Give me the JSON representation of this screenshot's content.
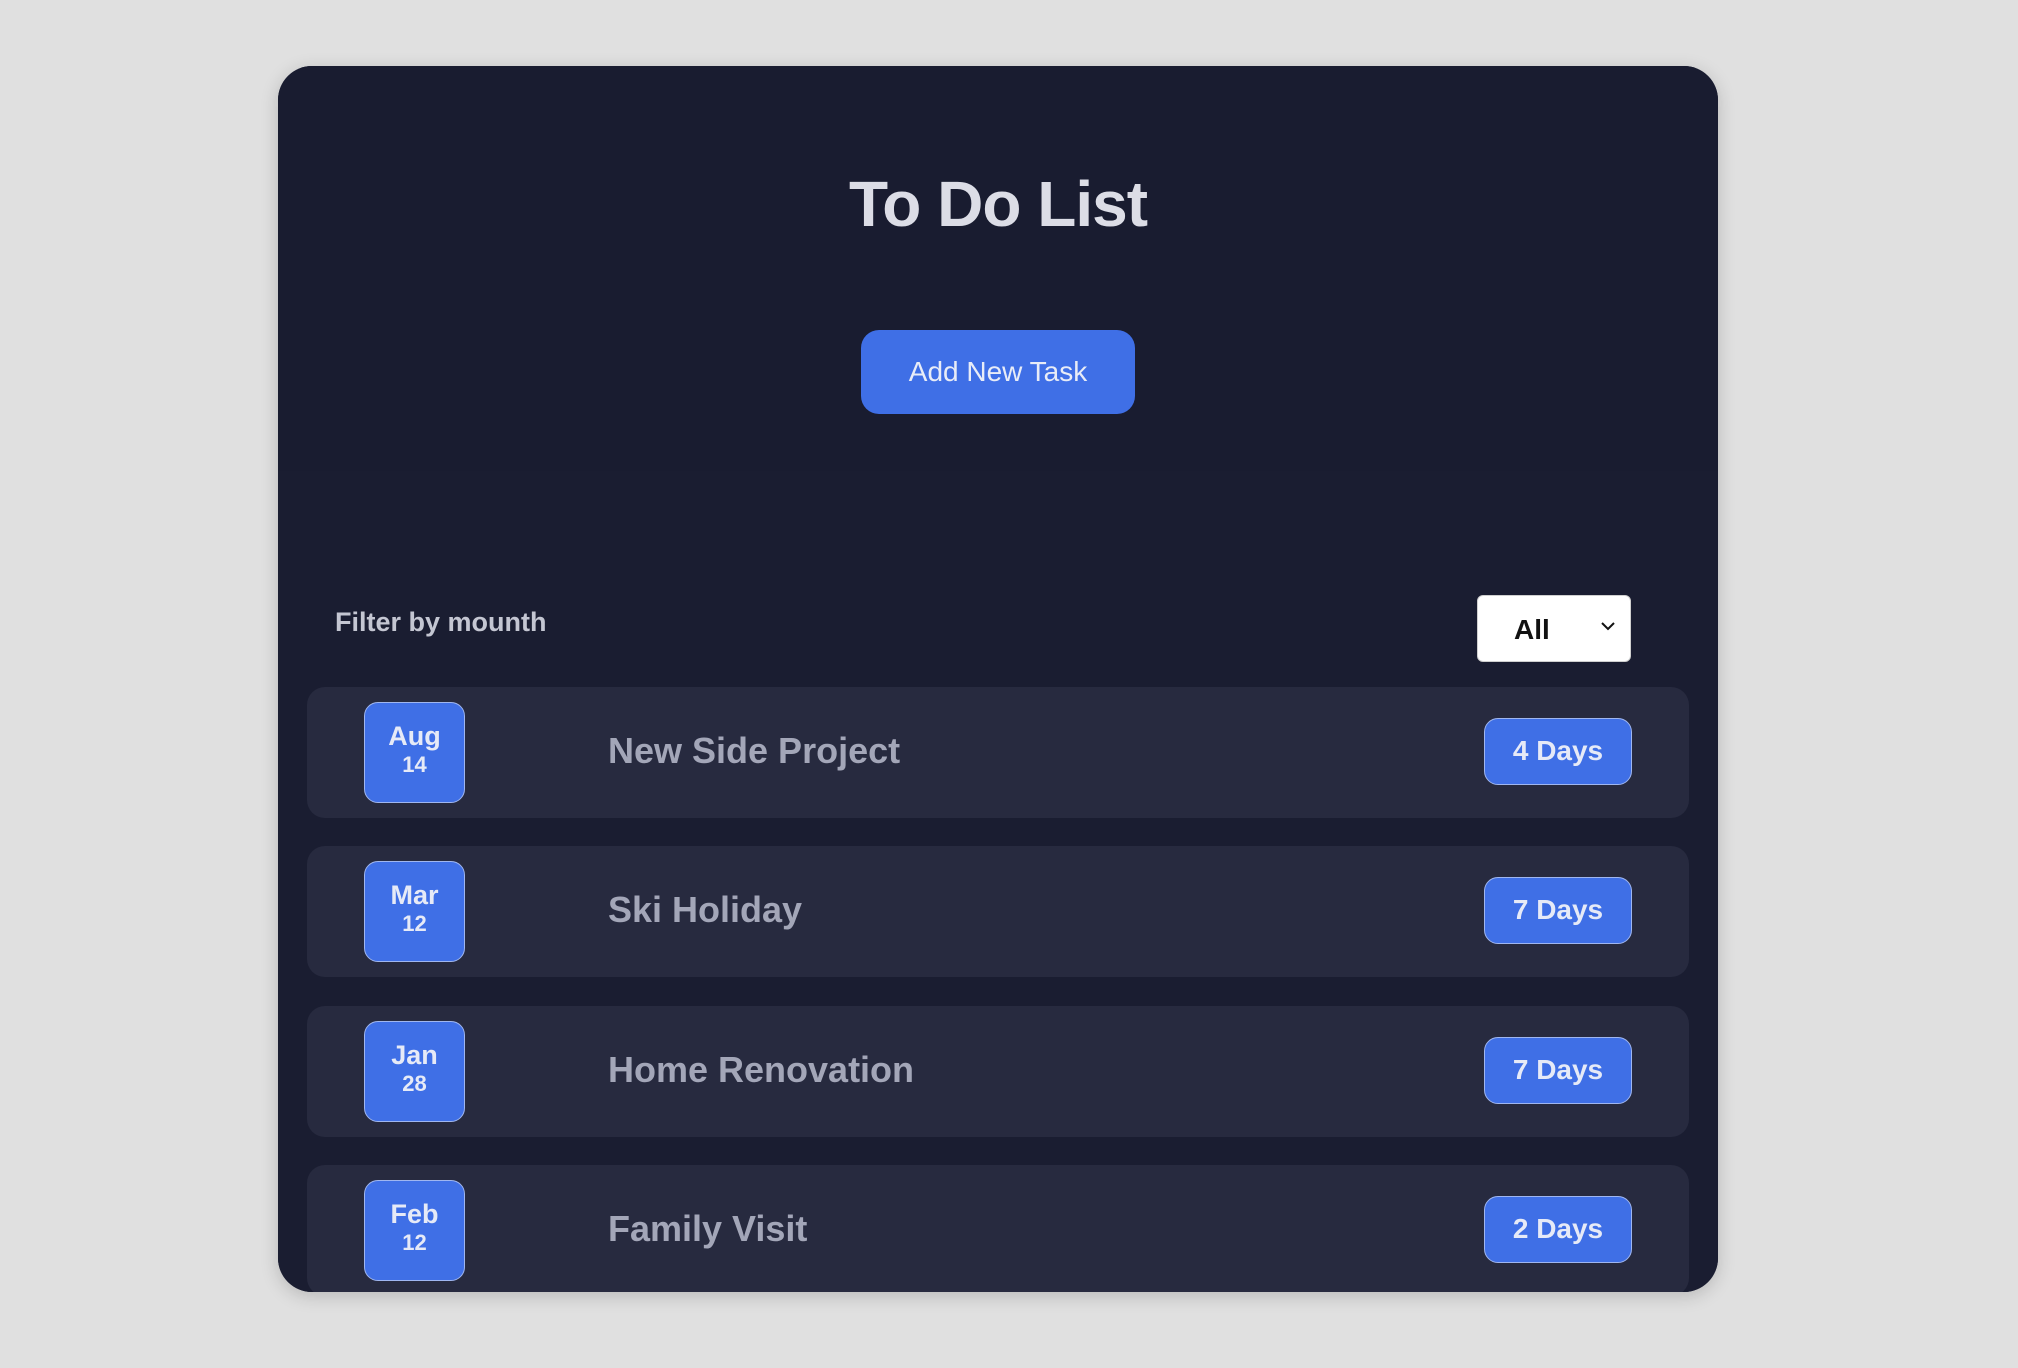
{
  "app": {
    "title": "To Do List",
    "add_button_label": "Add New Task"
  },
  "filter": {
    "label": "Filter by mounth",
    "selected": "All",
    "icon": "chevron-down-icon"
  },
  "tasks": [
    {
      "month": "Aug",
      "day": "14",
      "name": "New Side Project",
      "duration": "4 Days"
    },
    {
      "month": "Mar",
      "day": "12",
      "name": "Ski Holiday",
      "duration": "7 Days"
    },
    {
      "month": "Jan",
      "day": "28",
      "name": "Home Renovation",
      "duration": "7 Days"
    },
    {
      "month": "Feb",
      "day": "12",
      "name": "Family Visit",
      "duration": "2 Days"
    }
  ],
  "colors": {
    "accent": "#3f6fe6",
    "card_background": "#1a1d31",
    "task_background": "#272a3f",
    "page_background": "#e0e0e0"
  }
}
